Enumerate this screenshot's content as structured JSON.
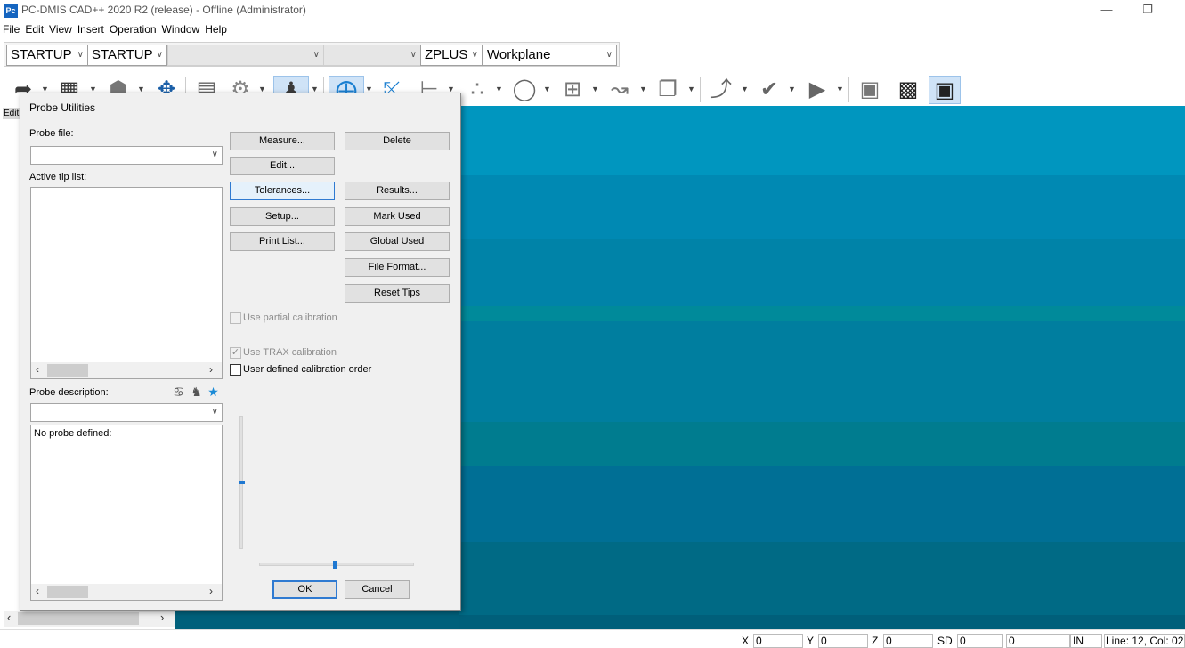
{
  "window": {
    "app_icon": "Pc",
    "title": "PC-DMIS CAD++ 2020 R2 (release) - Offline (Administrator)",
    "minimize": "—",
    "maximize": "❐"
  },
  "menu": [
    "File",
    "Edit",
    "View",
    "Insert",
    "Operation",
    "Window",
    "Help"
  ],
  "combos": {
    "probe": "STARTUP",
    "alignment": "STARTUP",
    "empty1": "",
    "empty2": "",
    "workplane_dir": "ZPLUS",
    "workplane": "Workplane"
  },
  "toolbar_icons": [
    "pointer-icon",
    "solid-view-icon",
    "cube-icon",
    "move-icon",
    "edit-window-icon",
    "settings-icon",
    "probe-mode-icon",
    "rotate-icon",
    "axis-icon",
    "dimension-icon",
    "points-icon",
    "circle-icon",
    "grid-icon",
    "constructed-icon",
    "copy-icon",
    "path-icon",
    "check-icon",
    "play-icon",
    "camera-icon",
    "report-icon",
    "status-window-icon"
  ],
  "left_panel": {
    "edit_tab": "Edit"
  },
  "dialog": {
    "title": "Probe Utilities",
    "probe_file_label": "Probe file:",
    "probe_file_value": "",
    "active_tip_label": "Active tip list:",
    "probe_desc_label": "Probe description:",
    "probe_desc_value": "",
    "probe_desc_text": "No probe defined:",
    "buttons": {
      "measure": "Measure...",
      "delete": "Delete",
      "edit": "Edit...",
      "tolerances": "Tolerances...",
      "results": "Results...",
      "setup": "Setup...",
      "mark_used": "Mark Used",
      "print_list": "Print List...",
      "global_used": "Global Used",
      "file_format": "File Format...",
      "reset_tips": "Reset Tips",
      "ok": "OK",
      "cancel": "Cancel"
    },
    "checkboxes": {
      "partial": {
        "label": "Use partial calibration",
        "checked": false,
        "enabled": false
      },
      "trax": {
        "label": "Use TRAX calibration",
        "checked": true,
        "enabled": false
      },
      "user_order": {
        "label": "User defined calibration order",
        "checked": false,
        "enabled": true
      }
    }
  },
  "status": {
    "x_label": "X",
    "x_value": "0",
    "y_label": "Y",
    "y_value": "0",
    "z_label": "Z",
    "z_value": "0",
    "sd_label": "SD",
    "sd_value": "0",
    "extra_value": "0",
    "units": "IN",
    "line_col": "Line: 12, Col: 02"
  }
}
